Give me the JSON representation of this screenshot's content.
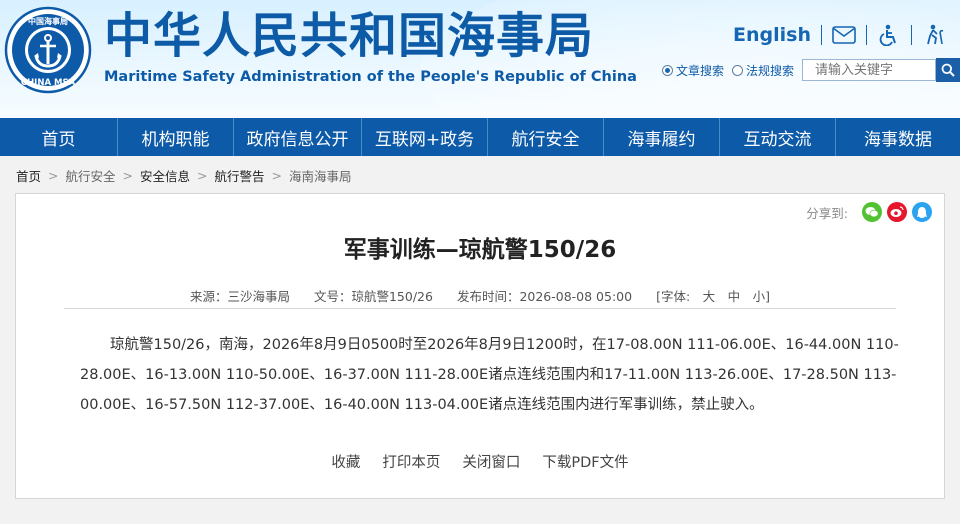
{
  "header": {
    "title": "中华人民共和国海事局",
    "subtitle": "Maritime Safety Administration of the People's Republic of China",
    "logo_text": "CHINA MSA",
    "logo_chars": "中国海事局",
    "english_label": "English",
    "icons": [
      "mail-icon",
      "accessibility-icon",
      "elder-mode-icon"
    ],
    "search": {
      "option_article": "文章搜索",
      "option_law": "法规搜索",
      "placeholder": "请输入关键字"
    }
  },
  "nav": {
    "items": [
      {
        "label": "首页",
        "w": 118
      },
      {
        "label": "机构职能",
        "w": 116
      },
      {
        "label": "政府信息公开",
        "w": 128
      },
      {
        "label": "互联网+政务",
        "w": 126
      },
      {
        "label": "航行安全",
        "w": 116
      },
      {
        "label": "海事履约",
        "w": 116
      },
      {
        "label": "互动交流",
        "w": 116
      },
      {
        "label": "海事数据",
        "w": 124
      }
    ]
  },
  "breadcrumb": [
    "首页",
    "航行安全",
    "安全信息",
    "航行警告",
    "海南海事局"
  ],
  "article": {
    "share_label": "分享到:",
    "title": "军事训练—琼航警150/26",
    "source": "来源：三沙海事局",
    "doc_no": "文号：琼航警150/26",
    "publish_time": "发布时间：2026-08-08 05:00",
    "font_size": "[字体:　大　中　小]",
    "body": "琼航警150/26，南海，2026年8月9日0500时至2026年8月9日1200时，在17-08.00N 111-06.00E、16-44.00N 110-28.00E、16-13.00N 110-50.00E、16-37.00N 111-28.00E诸点连线范围内和17-11.00N 113-26.00E、17-28.50N 113-00.00E、16-57.50N 112-37.00E、16-40.00N 113-04.00E诸点连线范围内进行军事训练，禁止驶入。",
    "actions": [
      "收藏",
      "打印本页",
      "关闭窗口",
      "下载PDF文件"
    ]
  },
  "colors": {
    "brand_blue": "#0c5aa8",
    "wechat": "#51c332",
    "weibo": "#e6162d",
    "qzone": "#2aa3f0"
  }
}
